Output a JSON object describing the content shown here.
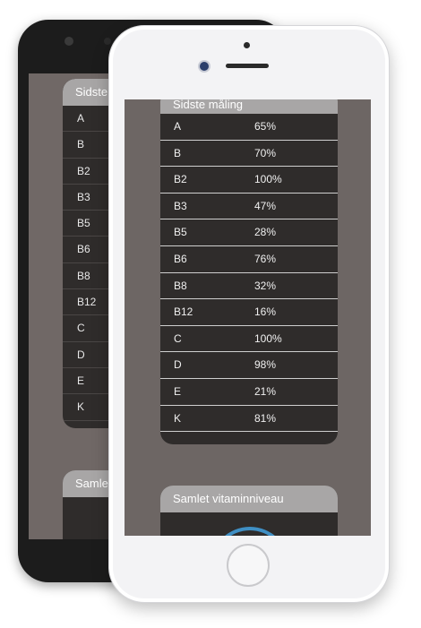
{
  "colors": {
    "screen_bg": "#6d6664",
    "card_bg": "#2f2c2b",
    "card_header_bg": "#a8a6a6",
    "gauge_accent": "#3f8fc4"
  },
  "back_phone": {
    "card_title": "Sidste",
    "rows": [
      "A",
      "B",
      "B2",
      "B3",
      "B5",
      "B6",
      "B8",
      "B12",
      "C",
      "D",
      "E",
      "K"
    ],
    "card2_title": "Samle"
  },
  "front_phone": {
    "card_title": "Sidste måling",
    "rows": [
      {
        "label": "A",
        "value": "65%"
      },
      {
        "label": "B",
        "value": "70%"
      },
      {
        "label": "B2",
        "value": "100%"
      },
      {
        "label": "B3",
        "value": "47%"
      },
      {
        "label": "B5",
        "value": "28%"
      },
      {
        "label": "B6",
        "value": "76%"
      },
      {
        "label": "B8",
        "value": "32%"
      },
      {
        "label": "B12",
        "value": "16%"
      },
      {
        "label": "C",
        "value": "100%"
      },
      {
        "label": "D",
        "value": "98%"
      },
      {
        "label": "E",
        "value": "21%"
      },
      {
        "label": "K",
        "value": "81%"
      }
    ],
    "card2_title": "Samlet vitaminniveau"
  }
}
